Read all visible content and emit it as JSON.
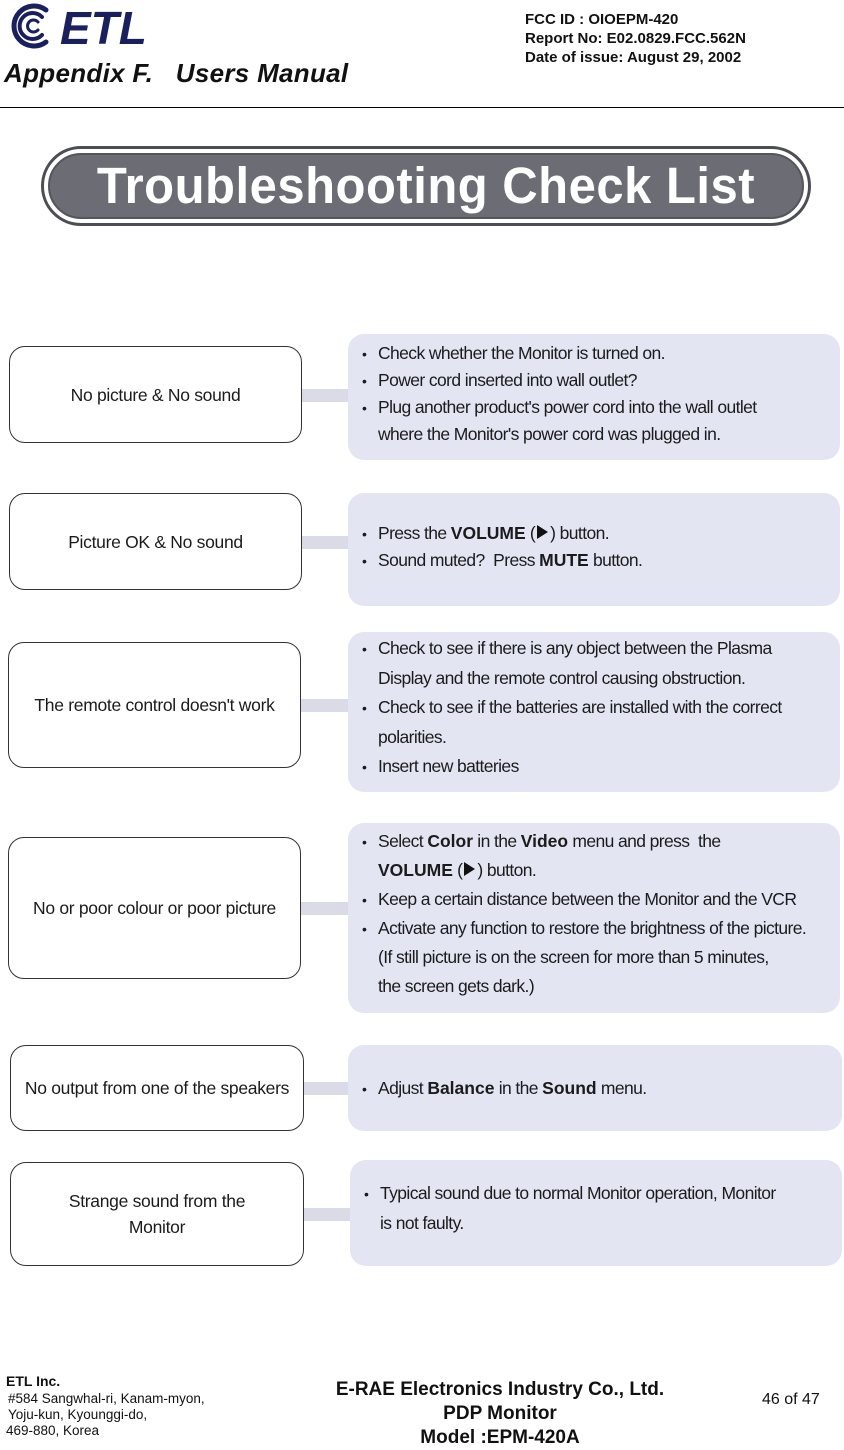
{
  "header": {
    "logo_text": "ETL",
    "appendix_title": "Appendix F.   Users Manual",
    "fcc_id": "FCC ID : OIOEPM-420",
    "report_no": "Report No: E02.0829.FCC.562N",
    "date_of_issue": "Date of issue: August 29, 2002"
  },
  "banner": {
    "title": "Troubleshooting Check List"
  },
  "rows": [
    {
      "problem": "No picture & No sound",
      "solutions": [
        [
          {
            "t": "Check whether the Monitor is turned on."
          }
        ],
        [
          {
            "t": "Power cord inserted into wall outlet?"
          }
        ],
        [
          {
            "t": "Plug another product's power cord into the wall outlet"
          }
        ],
        [
          {
            "t": "where the Monitor's power cord was plugged in."
          }
        ]
      ],
      "bullets": [
        true,
        true,
        true,
        false
      ]
    },
    {
      "problem": "Picture OK & No sound",
      "solutions": [
        [
          {
            "t": "Press the "
          },
          {
            "t": "VOLUME",
            "b": true
          },
          {
            "t": " ("
          },
          {
            "icon": "play-triangle-icon"
          },
          {
            "t": ") button."
          }
        ],
        [
          {
            "t": "Sound muted?  Press "
          },
          {
            "t": "MUTE",
            "b": true
          },
          {
            "t": " button."
          }
        ]
      ],
      "bullets": [
        true,
        true
      ]
    },
    {
      "problem": "The remote control doesn't work",
      "solutions": [
        [
          {
            "t": "Check to see if there is any object between the Plasma"
          }
        ],
        [
          {
            "t": "Display and the remote control causing obstruction."
          }
        ],
        [
          {
            "t": "Check to see if the batteries are installed with the correct"
          }
        ],
        [
          {
            "t": "polarities."
          }
        ],
        [
          {
            "t": "Insert new batteries"
          }
        ]
      ],
      "bullets": [
        true,
        false,
        true,
        false,
        true
      ]
    },
    {
      "problem": "No or poor colour or poor picture",
      "solutions": [
        [
          {
            "t": "Select "
          },
          {
            "t": "Color",
            "b": true
          },
          {
            "t": " in the "
          },
          {
            "t": "Video",
            "b": true
          },
          {
            "t": " menu and press  the"
          }
        ],
        [
          {
            "t": "VOLUME",
            "b": true
          },
          {
            "t": " ("
          },
          {
            "icon": "play-triangle-icon"
          },
          {
            "t": ") button."
          }
        ],
        [
          {
            "t": "Keep a certain distance between the Monitor and the VCR"
          }
        ],
        [
          {
            "t": "Activate any function to restore the brightness of the picture."
          }
        ],
        [
          {
            "t": "(If still picture is on the screen for more than 5 minutes,"
          }
        ],
        [
          {
            "t": "the screen gets dark.)"
          }
        ]
      ],
      "bullets": [
        true,
        false,
        true,
        true,
        false,
        false
      ]
    },
    {
      "problem": "No output from one of the speakers",
      "solutions": [
        [
          {
            "t": "Adjust "
          },
          {
            "t": "Balance",
            "b": true
          },
          {
            "t": " in the "
          },
          {
            "t": "Sound",
            "b": true
          },
          {
            "t": " menu."
          }
        ]
      ],
      "bullets": [
        true
      ]
    },
    {
      "problem": "Strange sound from the Monitor",
      "solutions": [
        [
          {
            "t": "Typical sound due to normal Monitor operation, Monitor"
          }
        ],
        [
          {
            "t": "is not faulty."
          }
        ]
      ],
      "bullets": [
        true,
        false
      ]
    }
  ],
  "footer": {
    "company": "ETL Inc.",
    "address_line1": "#584 Sangwhal-ri, Kanam-myon,",
    "address_line2": "Yoju-kun, Kyounggi-do,",
    "address_line3": "469-880, Korea",
    "manufacturer": "E-RAE Electronics Industry Co., Ltd.",
    "product": "PDP Monitor",
    "model": "Model :EPM-420A",
    "page": "46 of 47"
  },
  "colors": {
    "banner_fill": "#6c6c74",
    "solution_fill": "#e4e5f3",
    "logo_blue": "#1a1f5e"
  }
}
